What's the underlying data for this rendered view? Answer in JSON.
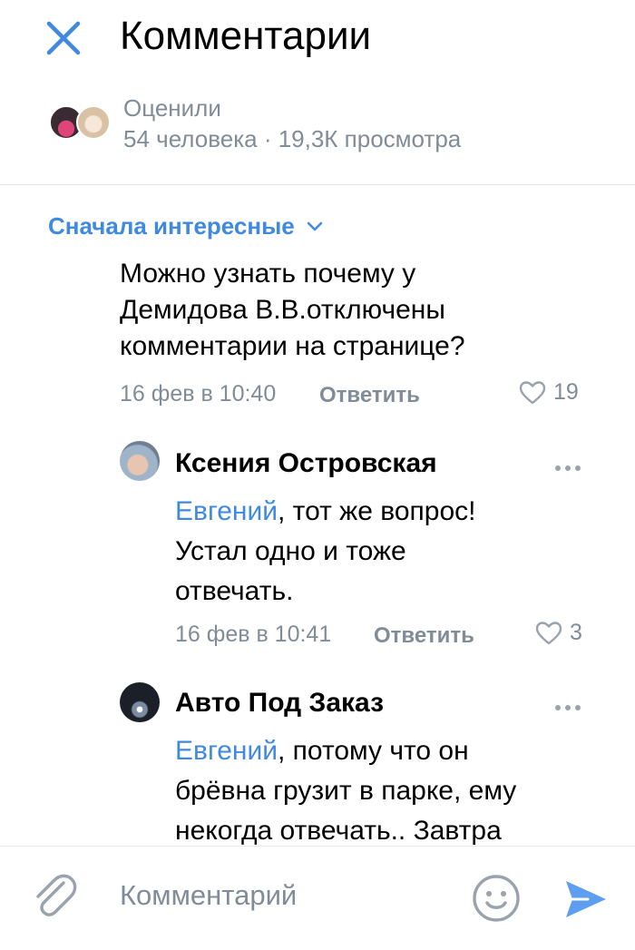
{
  "header": {
    "title": "Комментарии",
    "close_icon": "close-icon"
  },
  "likes": {
    "label": "Оценили",
    "stats": "54 человека · 19,3К просмотра"
  },
  "sort": {
    "label": "Сначала интересные"
  },
  "comments": [
    {
      "text_lines": [
        "Можно узнать почему у",
        "Демидова В.В.отключены",
        "комментарии на странице?"
      ],
      "time": "16 фев в 10:40",
      "reply_label": "Ответить",
      "likes": "19"
    },
    {
      "author": "Ксения Островская",
      "mention": "Евгений",
      "text_first": ", тот же вопрос!",
      "text_lines": [
        "Устал одно и тоже",
        "отвечать."
      ],
      "time": "16 фев в 10:41",
      "reply_label": "Ответить",
      "likes": "3"
    },
    {
      "author": "Авто Под Заказ",
      "mention": "Евгений",
      "text_first": ", потому что он",
      "text_lines": [
        "брёвна грузит в парке, ему",
        "некогда отвечать.. Завтра"
      ]
    }
  ],
  "composer": {
    "placeholder": "Комментарий"
  },
  "colors": {
    "accent": "#3f8ae0",
    "secondary": "#818c99"
  }
}
